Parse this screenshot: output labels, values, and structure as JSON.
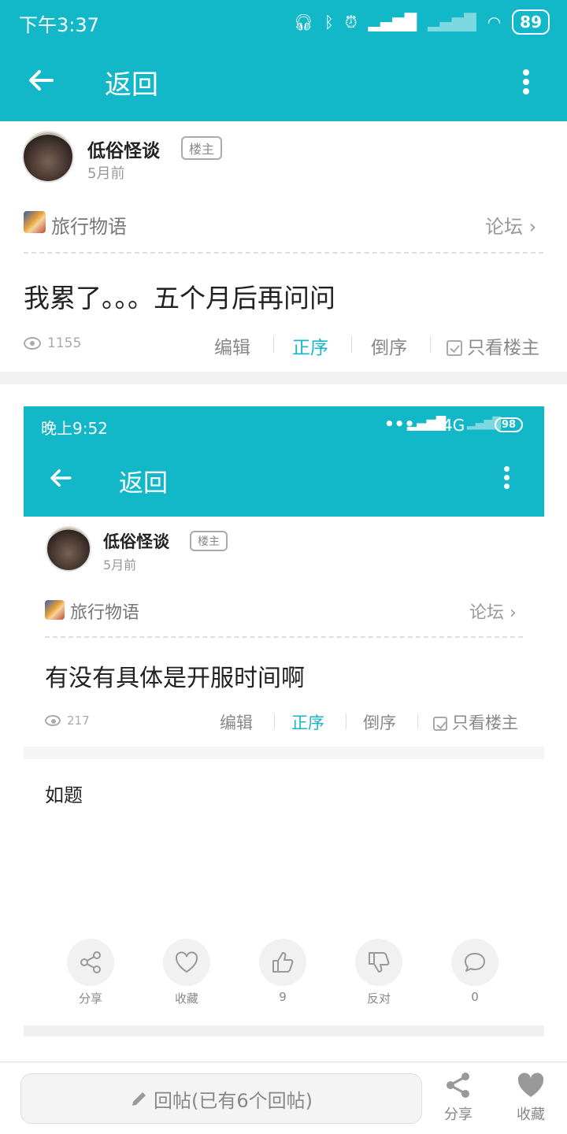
{
  "status": {
    "time": "下午3:37",
    "battery": "89"
  },
  "appbar": {
    "title": "返回"
  },
  "post": {
    "author": "低俗怪谈",
    "badge": "楼主",
    "ago": "5月前",
    "forum": "旅行物语",
    "forum_link": "论坛",
    "title": "我累了。。。五个月后再问问",
    "views": "1155",
    "actions": {
      "edit": "编辑",
      "asc": "正序",
      "desc": "倒序",
      "only_op": "只看楼主"
    }
  },
  "embedded": {
    "status": {
      "time": "晚上9:52",
      "network": "4G",
      "battery": "98"
    },
    "appbar": {
      "title": "返回"
    },
    "post": {
      "author": "低俗怪谈",
      "badge": "楼主",
      "ago": "5月前",
      "forum": "旅行物语",
      "forum_link": "论坛",
      "title": "有没有具体是开服时间啊",
      "views": "217",
      "actions": {
        "edit": "编辑",
        "asc": "正序",
        "desc": "倒序",
        "only_op": "只看楼主"
      }
    },
    "content": "如题",
    "buttons": [
      {
        "label": "分享",
        "icon": "share-icon"
      },
      {
        "label": "收藏",
        "icon": "heart-icon"
      },
      {
        "label": "9",
        "icon": "thumbs-up-icon"
      },
      {
        "label": "反对",
        "icon": "thumbs-down-icon"
      },
      {
        "label": "0",
        "icon": "comment-icon"
      }
    ]
  },
  "bottombar": {
    "reply": "回帖(已有6个回帖)",
    "share": "分享",
    "favorite": "收藏"
  },
  "colors": {
    "accent": "#13b8c8"
  }
}
